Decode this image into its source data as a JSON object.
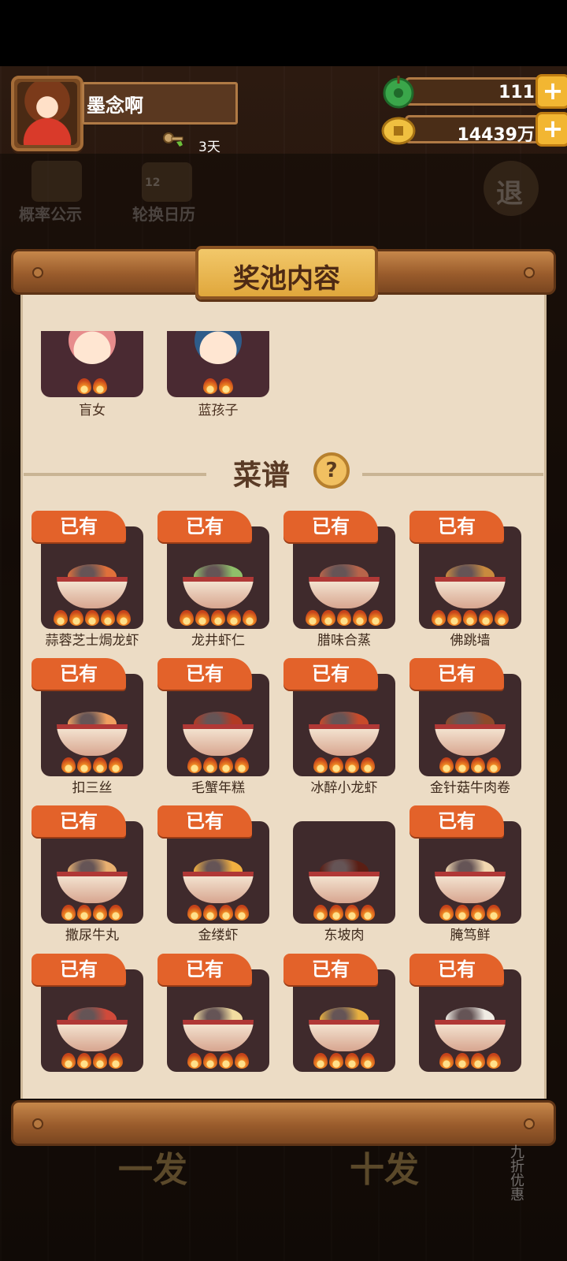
{
  "player": {
    "name": "墨念啊",
    "days": "3天"
  },
  "currency": {
    "jade": "111",
    "coins": "14439万"
  },
  "background_buttons": {
    "probability": "概率公示",
    "calendar": "轮换日历",
    "calendar_badge": "12",
    "exit": "退",
    "single_draw": "一发",
    "ten_draw": "十发",
    "discount": "九折优惠"
  },
  "panel": {
    "title": "奖池内容",
    "characters": [
      {
        "name": "盲女"
      },
      {
        "name": "蓝孩子"
      }
    ],
    "recipes_title": "菜谱",
    "help": "?",
    "owned_label": "已有",
    "recipes": [
      {
        "name": "蒜蓉芝士焗龙虾",
        "owned": true,
        "food": "#e0703a",
        "stars": 5
      },
      {
        "name": "龙井虾仁",
        "owned": true,
        "food": "#8fc06a",
        "stars": 5
      },
      {
        "name": "腊味合蒸",
        "owned": true,
        "food": "#b8644a",
        "stars": 5
      },
      {
        "name": "佛跳墙",
        "owned": true,
        "food": "#c98a3e",
        "stars": 5
      },
      {
        "name": "扣三丝",
        "owned": true,
        "food": "#f0a060",
        "stars": 4
      },
      {
        "name": "毛蟹年糕",
        "owned": true,
        "food": "#b23a24",
        "stars": 4
      },
      {
        "name": "冰醉小龙虾",
        "owned": true,
        "food": "#c84a2a",
        "stars": 4
      },
      {
        "name": "金针菇牛肉卷",
        "owned": true,
        "food": "#8c4a2a",
        "stars": 4
      },
      {
        "name": "撒尿牛丸",
        "owned": true,
        "food": "#e8b070",
        "stars": 4
      },
      {
        "name": "金缕虾",
        "owned": true,
        "food": "#f2b040",
        "stars": 4
      },
      {
        "name": "东坡肉",
        "owned": false,
        "food": "#5a1e14",
        "stars": 4
      },
      {
        "name": "腌笃鲜",
        "owned": true,
        "food": "#f2d8b0",
        "stars": 4
      },
      {
        "name": "",
        "owned": true,
        "food": "#d04a3a",
        "stars": 4
      },
      {
        "name": "",
        "owned": true,
        "food": "#f2dca0",
        "stars": 4
      },
      {
        "name": "",
        "owned": true,
        "food": "#e8b040",
        "stars": 4
      },
      {
        "name": "",
        "owned": true,
        "food": "#f0ece4",
        "stars": 4
      }
    ]
  },
  "colors": {
    "badge": "#e3622a",
    "card": "#3f2a2c",
    "paper": "#ecdcc5"
  }
}
